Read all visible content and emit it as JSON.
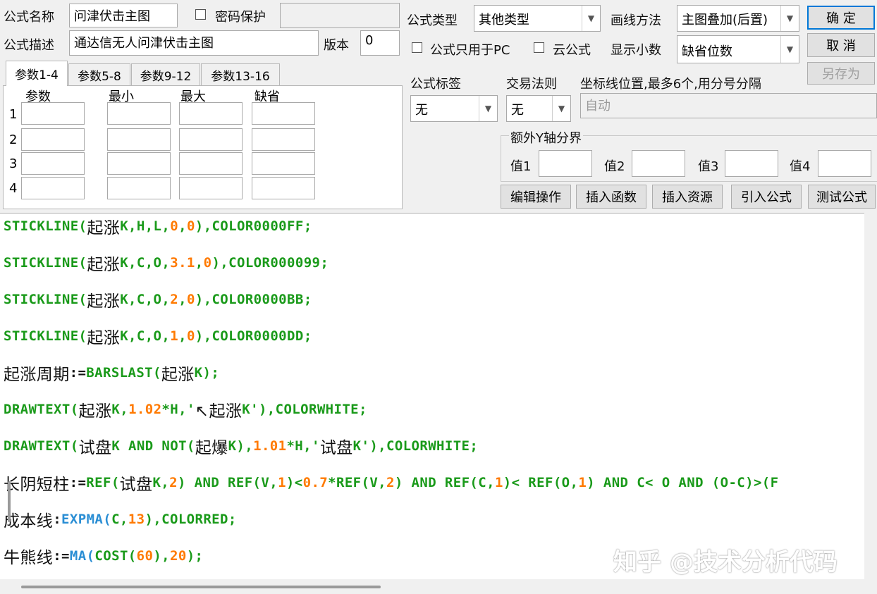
{
  "form": {
    "name_label": "公式名称",
    "name_value": "问津伏击主图",
    "password_label": "密码保护",
    "password_value": "",
    "desc_label": "公式描述",
    "desc_value": "通达信无人问津伏击主图",
    "version_label": "版本",
    "version_value": "0",
    "type_label": "公式类型",
    "type_value": "其他类型",
    "draw_label": "画线方法",
    "draw_value": "主图叠加(后置)",
    "pc_only_label": "公式只用于PC",
    "cloud_label": "云公式",
    "decimals_label": "显示小数",
    "decimals_value": "缺省位数",
    "tag_label": "公式标签",
    "tag_value": "无",
    "trade_rule_label": "交易法则",
    "trade_rule_value": "无",
    "axis_label": "坐标线位置,最多6个,用分号分隔",
    "axis_value": "自动"
  },
  "buttons": {
    "ok": "确 定",
    "cancel": "取 消",
    "save_as": "另存为",
    "edit_ops": "编辑操作",
    "insert_func": "插入函数",
    "insert_res": "插入资源",
    "import_formula": "引入公式",
    "test_formula": "测试公式"
  },
  "tabs": [
    "参数1-4",
    "参数5-8",
    "参数9-12",
    "参数13-16"
  ],
  "params": {
    "headers": [
      "参数",
      "最小",
      "最大",
      "缺省"
    ],
    "rows": [
      "1",
      "2",
      "3",
      "4"
    ]
  },
  "extra_y": {
    "title": "额外Y轴分界",
    "labels": [
      "值1",
      "值2",
      "值3",
      "值4"
    ]
  },
  "code_lines": [
    [
      {
        "t": "STICKLINE(",
        "c": "k"
      },
      {
        "t": "起涨",
        "c": "cn"
      },
      {
        "t": "K,H,L,",
        "c": "k"
      },
      {
        "t": "0",
        "c": "n"
      },
      {
        "t": ",",
        "c": "k"
      },
      {
        "t": "0",
        "c": "n"
      },
      {
        "t": "),COLOR0000FF;",
        "c": "k"
      }
    ],
    [
      {
        "t": "STICKLINE(",
        "c": "k"
      },
      {
        "t": "起涨",
        "c": "cn"
      },
      {
        "t": "K,C,O,",
        "c": "k"
      },
      {
        "t": "3.1",
        "c": "n"
      },
      {
        "t": ",",
        "c": "k"
      },
      {
        "t": "0",
        "c": "n"
      },
      {
        "t": "),COLOR000099;",
        "c": "k"
      }
    ],
    [
      {
        "t": "STICKLINE(",
        "c": "k"
      },
      {
        "t": "起涨",
        "c": "cn"
      },
      {
        "t": "K,C,O,",
        "c": "k"
      },
      {
        "t": "2",
        "c": "n"
      },
      {
        "t": ",",
        "c": "k"
      },
      {
        "t": "0",
        "c": "n"
      },
      {
        "t": "),COLOR0000BB;",
        "c": "k"
      }
    ],
    [
      {
        "t": "STICKLINE(",
        "c": "k"
      },
      {
        "t": "起涨",
        "c": "cn"
      },
      {
        "t": "K,C,O,",
        "c": "k"
      },
      {
        "t": "1",
        "c": "n"
      },
      {
        "t": ",",
        "c": "k"
      },
      {
        "t": "0",
        "c": "n"
      },
      {
        "t": "),COLOR0000DD;",
        "c": "k"
      }
    ],
    [
      {
        "t": "起涨周期",
        "c": "cn"
      },
      {
        "t": ":=",
        "c": "p"
      },
      {
        "t": "BARSLAST(",
        "c": "k"
      },
      {
        "t": "起涨",
        "c": "cn"
      },
      {
        "t": "K);",
        "c": "k"
      }
    ],
    [
      {
        "t": "DRAWTEXT(",
        "c": "k"
      },
      {
        "t": "起涨",
        "c": "cn"
      },
      {
        "t": "K,",
        "c": "k"
      },
      {
        "t": "1.02",
        "c": "n"
      },
      {
        "t": "*H,'",
        "c": "k"
      },
      {
        "t": "↖起涨",
        "c": "cn"
      },
      {
        "t": "K'),COLORWHITE;",
        "c": "k"
      }
    ],
    [
      {
        "t": "DRAWTEXT(",
        "c": "k"
      },
      {
        "t": "试盘",
        "c": "cn"
      },
      {
        "t": "K AND NOT(",
        "c": "k"
      },
      {
        "t": "起爆",
        "c": "cn"
      },
      {
        "t": "K),",
        "c": "k"
      },
      {
        "t": "1.01",
        "c": "n"
      },
      {
        "t": "*H,'",
        "c": "k"
      },
      {
        "t": "试盘",
        "c": "cn"
      },
      {
        "t": "K'),COLORWHITE;",
        "c": "k"
      }
    ],
    [
      {
        "t": "长阴短柱",
        "c": "cn"
      },
      {
        "t": ":=",
        "c": "p"
      },
      {
        "t": "REF(",
        "c": "k"
      },
      {
        "t": "试盘",
        "c": "cn"
      },
      {
        "t": "K,",
        "c": "k"
      },
      {
        "t": "2",
        "c": "n"
      },
      {
        "t": ") AND REF(V,",
        "c": "k"
      },
      {
        "t": "1",
        "c": "n"
      },
      {
        "t": ")< ",
        "c": "k"
      },
      {
        "t": "0.7",
        "c": "n"
      },
      {
        "t": "*REF(V,",
        "c": "k"
      },
      {
        "t": "2",
        "c": "n"
      },
      {
        "t": ") AND REF(C,",
        "c": "k"
      },
      {
        "t": "1",
        "c": "n"
      },
      {
        "t": ")< REF(O,",
        "c": "k"
      },
      {
        "t": "1",
        "c": "n"
      },
      {
        "t": ") AND C< O AND (O-C)>(F",
        "c": "k"
      }
    ],
    [
      {
        "t": "成本线",
        "c": "cn"
      },
      {
        "t": ":",
        "c": "p"
      },
      {
        "t": "EXPMA(",
        "c": "b"
      },
      {
        "t": "C,",
        "c": "k"
      },
      {
        "t": "13",
        "c": "n"
      },
      {
        "t": "),COLORRED;",
        "c": "k"
      }
    ],
    [
      {
        "t": "牛熊线",
        "c": "cn"
      },
      {
        "t": ":=",
        "c": "p"
      },
      {
        "t": "MA(",
        "c": "b"
      },
      {
        "t": "COST(",
        "c": "k"
      },
      {
        "t": "60",
        "c": "n"
      },
      {
        "t": "),",
        "c": "k"
      },
      {
        "t": "20",
        "c": "n"
      },
      {
        "t": ");",
        "c": "k"
      }
    ]
  ],
  "watermark": "知乎 @技术分析代码"
}
